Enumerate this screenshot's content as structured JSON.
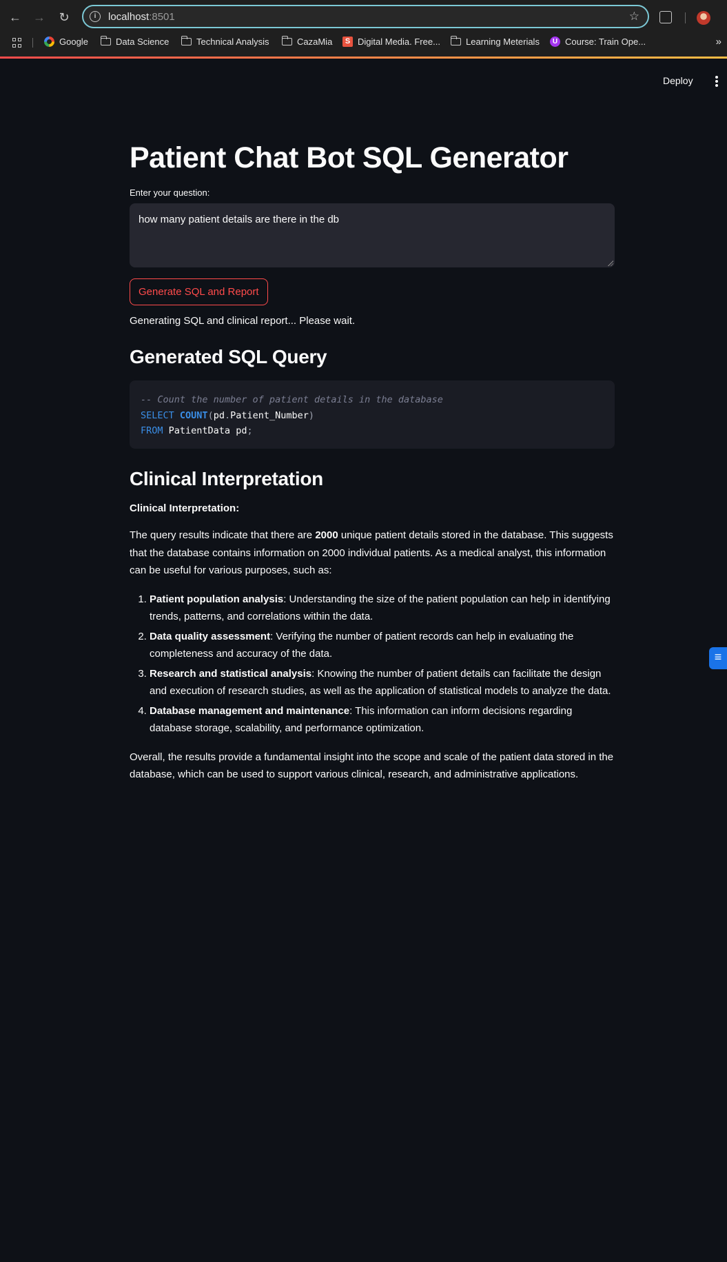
{
  "browser": {
    "url_host": "localhost",
    "url_port": ":8501",
    "bookmarks": [
      {
        "label": "Google",
        "icon": "google-icon"
      },
      {
        "label": "Data Science",
        "icon": "folder-icon"
      },
      {
        "label": "Technical Analysis",
        "icon": "folder-icon"
      },
      {
        "label": "CazaMia",
        "icon": "folder-icon"
      },
      {
        "label": "Digital Media. Free...",
        "icon": "s-icon"
      },
      {
        "label": "Learning Meterials",
        "icon": "folder-icon"
      },
      {
        "label": "Course: Train Ope...",
        "icon": "udemy-icon"
      }
    ],
    "more_label": "»"
  },
  "header": {
    "deploy_label": "Deploy"
  },
  "main": {
    "title": "Patient Chat Bot SQL Generator",
    "input_label": "Enter your question:",
    "question_value": "how many patient details are there in the db",
    "button_label": "Generate SQL and Report",
    "status_text": "Generating SQL and clinical report... Please wait.",
    "sql_heading": "Generated SQL Query",
    "sql": {
      "comment": "-- Count the number of patient details in the database",
      "line2_kw": "SELECT",
      "line2_fn": "COUNT",
      "line2_rest_open": "(",
      "line2_alias": "pd",
      "line2_dot": ".",
      "line2_col": "Patient_Number",
      "line2_close": ")",
      "line3_kw": "FROM",
      "line3_rest": "PatientData pd",
      "line3_end": ";"
    },
    "clinical_heading": "Clinical Interpretation",
    "clinical_subheading": "Clinical Interpretation:",
    "intro": {
      "pre": "The query results indicate that there are ",
      "bold": "2000",
      "post": " unique patient details stored in the database. This suggests that the database contains information on 2000 individual patients. As a medical analyst, this information can be useful for various purposes, such as:"
    },
    "points": [
      {
        "bold": "Patient population analysis",
        "text": ": Understanding the size of the patient population can help in identifying trends, patterns, and correlations within the data."
      },
      {
        "bold": "Data quality assessment",
        "text": ": Verifying the number of patient records can help in evaluating the completeness and accuracy of the data."
      },
      {
        "bold": "Research and statistical analysis",
        "text": ": Knowing the number of patient details can facilitate the design and execution of research studies, as well as the application of statistical models to analyze the data."
      },
      {
        "bold": "Database management and maintenance",
        "text": ": This information can inform decisions regarding database storage, scalability, and performance optimization."
      }
    ],
    "conclusion": "Overall, the results provide a fundamental insight into the scope and scale of the patient data stored in the database, which can be used to support various clinical, research, and administrative applications."
  },
  "colors": {
    "background": "#0e1117",
    "accent": "#ff4b4b",
    "input_bg": "#262730",
    "code_bg": "#1a1c24",
    "keyword": "#3a8ee6"
  }
}
